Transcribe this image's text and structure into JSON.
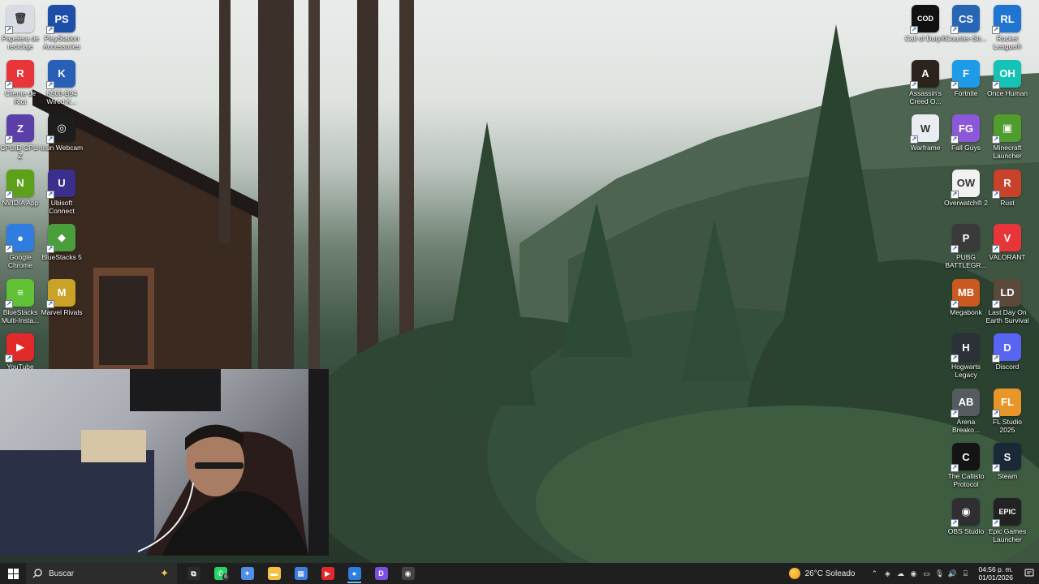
{
  "desktop": {
    "left_column_1": [
      {
        "label": "Papelera de reciclaje",
        "color": "#d9dde3",
        "glyph": "🗑"
      },
      {
        "label": "Cliente de Riot",
        "color": "#e8353a",
        "glyph": "R"
      },
      {
        "label": "CPUID CPU-Z",
        "color": "#5b3ea8",
        "glyph": "Z"
      },
      {
        "label": "NVIDIA App",
        "color": "#5da11a",
        "glyph": "N"
      },
      {
        "label": "Google Chrome",
        "color": "#2f7de1",
        "glyph": "●"
      },
      {
        "label": "BlueStacks Multi-Insta...",
        "color": "#61c236",
        "glyph": "≡"
      },
      {
        "label": "YouTube",
        "color": "#e22a2a",
        "glyph": "▶"
      }
    ],
    "left_column_2": [
      {
        "label": "PlayStation Accessories",
        "color": "#1e4fa8",
        "glyph": "PS"
      },
      {
        "label": "K500-B94 Wired K...",
        "color": "#2a5fb8",
        "glyph": "K"
      },
      {
        "label": "Iriun Webcam",
        "color": "#1d1d1d",
        "glyph": "◎"
      },
      {
        "label": "Ubisoft Connect",
        "color": "#3a2f8c",
        "glyph": "U"
      },
      {
        "label": "BlueStacks 5",
        "color": "#4a9e3c",
        "glyph": "◆"
      },
      {
        "label": "Marvel Rivals",
        "color": "#c9a227",
        "glyph": "M"
      }
    ],
    "right_column_1": [
      {
        "label": "Call of Duty®",
        "color": "#111111",
        "glyph": "COD"
      },
      {
        "label": "Assassin's Creed O...",
        "color": "#2b241c",
        "glyph": "A"
      },
      {
        "label": "Warframe",
        "color": "#e9edf2",
        "glyph": "W"
      }
    ],
    "right_column_2": [
      {
        "label": "Counter-Str...",
        "color": "#2766b4",
        "glyph": "CS"
      },
      {
        "label": "Fortnite",
        "color": "#1d9ae8",
        "glyph": "F"
      },
      {
        "label": "Fall Guys",
        "color": "#8c57d9",
        "glyph": "FG"
      },
      {
        "label": "Overwatch® 2",
        "color": "#f1f1f1",
        "glyph": "OW"
      },
      {
        "label": "PUBG BATTLEGR...",
        "color": "#3a3a3a",
        "glyph": "P"
      },
      {
        "label": "Megabonk",
        "color": "#c9591f",
        "glyph": "MB"
      },
      {
        "label": "Hogwarts Legacy",
        "color": "#2c3038",
        "glyph": "H"
      },
      {
        "label": "Arena Breako...",
        "color": "#565b60",
        "glyph": "AB"
      },
      {
        "label": "The Callisto Protocol",
        "color": "#141414",
        "glyph": "C"
      },
      {
        "label": "OBS Studio",
        "color": "#302e31",
        "glyph": "◉"
      }
    ],
    "right_column_3": [
      {
        "label": "Rocket League®",
        "color": "#1f75d0",
        "glyph": "RL"
      },
      {
        "label": "Once Human",
        "color": "#14c3b5",
        "glyph": "OH"
      },
      {
        "label": "Minecraft Launcher",
        "color": "#4f9d2d",
        "glyph": "▣"
      },
      {
        "label": "Rust",
        "color": "#c8412a",
        "glyph": "R"
      },
      {
        "label": "VALORANT",
        "color": "#e8353a",
        "glyph": "V"
      },
      {
        "label": "Last Day On Earth Survival",
        "color": "#5b4a3a",
        "glyph": "LD"
      },
      {
        "label": "Discord",
        "color": "#5865f2",
        "glyph": "D"
      },
      {
        "label": "FL Studio 2025",
        "color": "#e8952a",
        "glyph": "FL"
      },
      {
        "label": "Steam",
        "color": "#1b2838",
        "glyph": "S"
      },
      {
        "label": "Epic Games Launcher",
        "color": "#222222",
        "glyph": "EPIC"
      }
    ]
  },
  "taskbar": {
    "search_placeholder": "Buscar",
    "apps": [
      {
        "name": "task-view",
        "glyph": "⧉",
        "color": "#2b2b2b"
      },
      {
        "name": "whatsapp",
        "glyph": "✆",
        "color": "#25d366",
        "badge": "6"
      },
      {
        "name": "copilot",
        "glyph": "✦",
        "color": "#4f8fe8"
      },
      {
        "name": "file-explorer",
        "glyph": "▬",
        "color": "#f3c042"
      },
      {
        "name": "microsoft-store",
        "glyph": "▦",
        "color": "#3d7fe0"
      },
      {
        "name": "youtube",
        "glyph": "▶",
        "color": "#e22a2a"
      },
      {
        "name": "chrome",
        "glyph": "●",
        "color": "#2f7de1",
        "active": true
      },
      {
        "name": "discord",
        "glyph": "D",
        "color": "#7b4fe0"
      },
      {
        "name": "obs-record",
        "glyph": "◉",
        "color": "#444444"
      }
    ],
    "weather_text": "26°C  Soleado",
    "clock_time": "04:56 p. m.",
    "clock_date": "01/01/2026"
  }
}
